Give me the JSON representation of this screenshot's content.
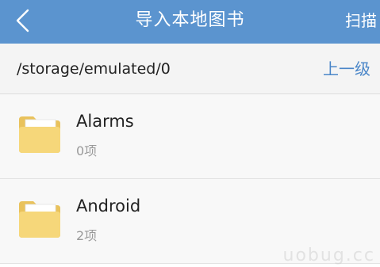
{
  "colors": {
    "topbar": "#5b94cf",
    "accent": "#4a86c8",
    "folder": "#f6d77a"
  },
  "header": {
    "back_icon": "chevron-left-icon",
    "title": "导入本地图书",
    "scan_label": "扫描"
  },
  "path_bar": {
    "path": "/storage/emulated/0",
    "up_label": "上一级"
  },
  "items": [
    {
      "name": "Alarms",
      "count": "0项",
      "icon": "folder-icon"
    },
    {
      "name": "Android",
      "count": "2项",
      "icon": "folder-icon"
    }
  ],
  "watermark": "uobug.cc"
}
